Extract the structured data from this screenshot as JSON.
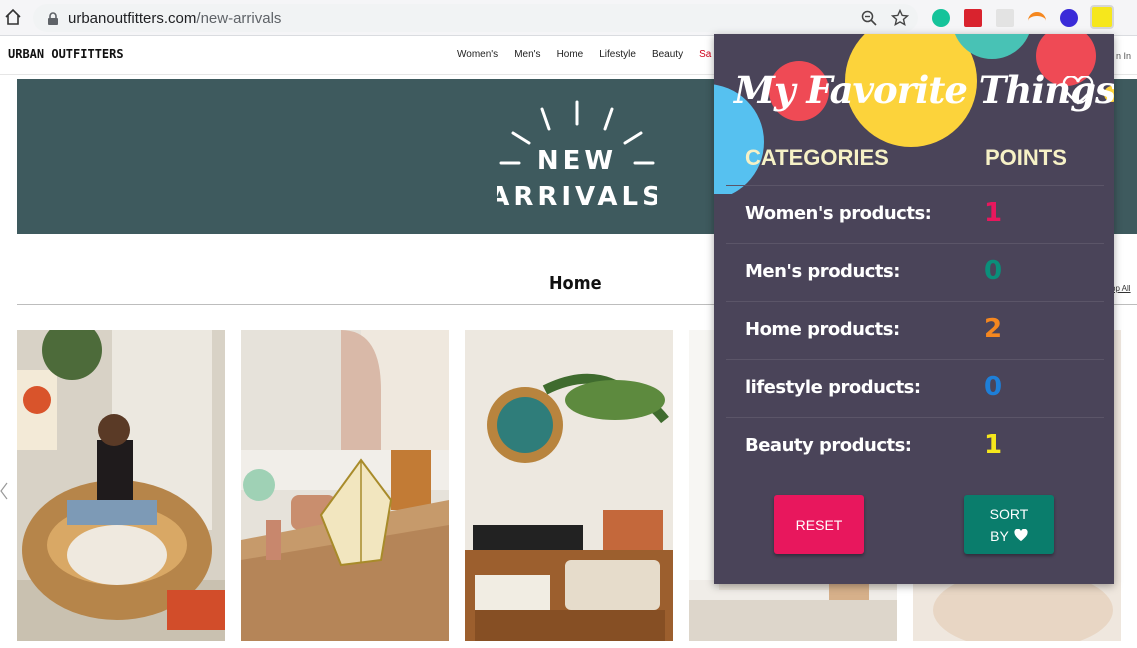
{
  "browser": {
    "url_host": "urbanoutfitters.com",
    "url_path": "/new-arrivals"
  },
  "site": {
    "logo": "URBAN OUTFITTERS",
    "nav": [
      "Women's",
      "Men's",
      "Home",
      "Lifestyle",
      "Beauty",
      "Sa"
    ],
    "signin": "n In",
    "hero_line1": "NEW",
    "hero_line2": "ARRIVALS",
    "section_title": "Home",
    "shop_all": "op All"
  },
  "popup": {
    "title": "My Favorite Things",
    "col_categories": "CATEGORIES",
    "col_points": "POINTS",
    "rows": [
      {
        "label": "Women's products:",
        "points": "1",
        "color": "#e8175d"
      },
      {
        "label": "Men's products:",
        "points": "0",
        "color": "#0a8f7a"
      },
      {
        "label": "Home products:",
        "points": "2",
        "color": "#f5871f"
      },
      {
        "label": "lifestyle products:",
        "points": "0",
        "color": "#1e7fd8"
      },
      {
        "label": "Beauty products:",
        "points": "1",
        "color": "#f6e71c"
      }
    ],
    "reset_label": "RESET",
    "sort_label_1": "SORT",
    "sort_label_2": "BY"
  },
  "colors": {
    "popup_bg": "#4a4459",
    "reset": "#e8175d",
    "sort": "#0a7d6c",
    "hero": "#3e5a5e"
  }
}
